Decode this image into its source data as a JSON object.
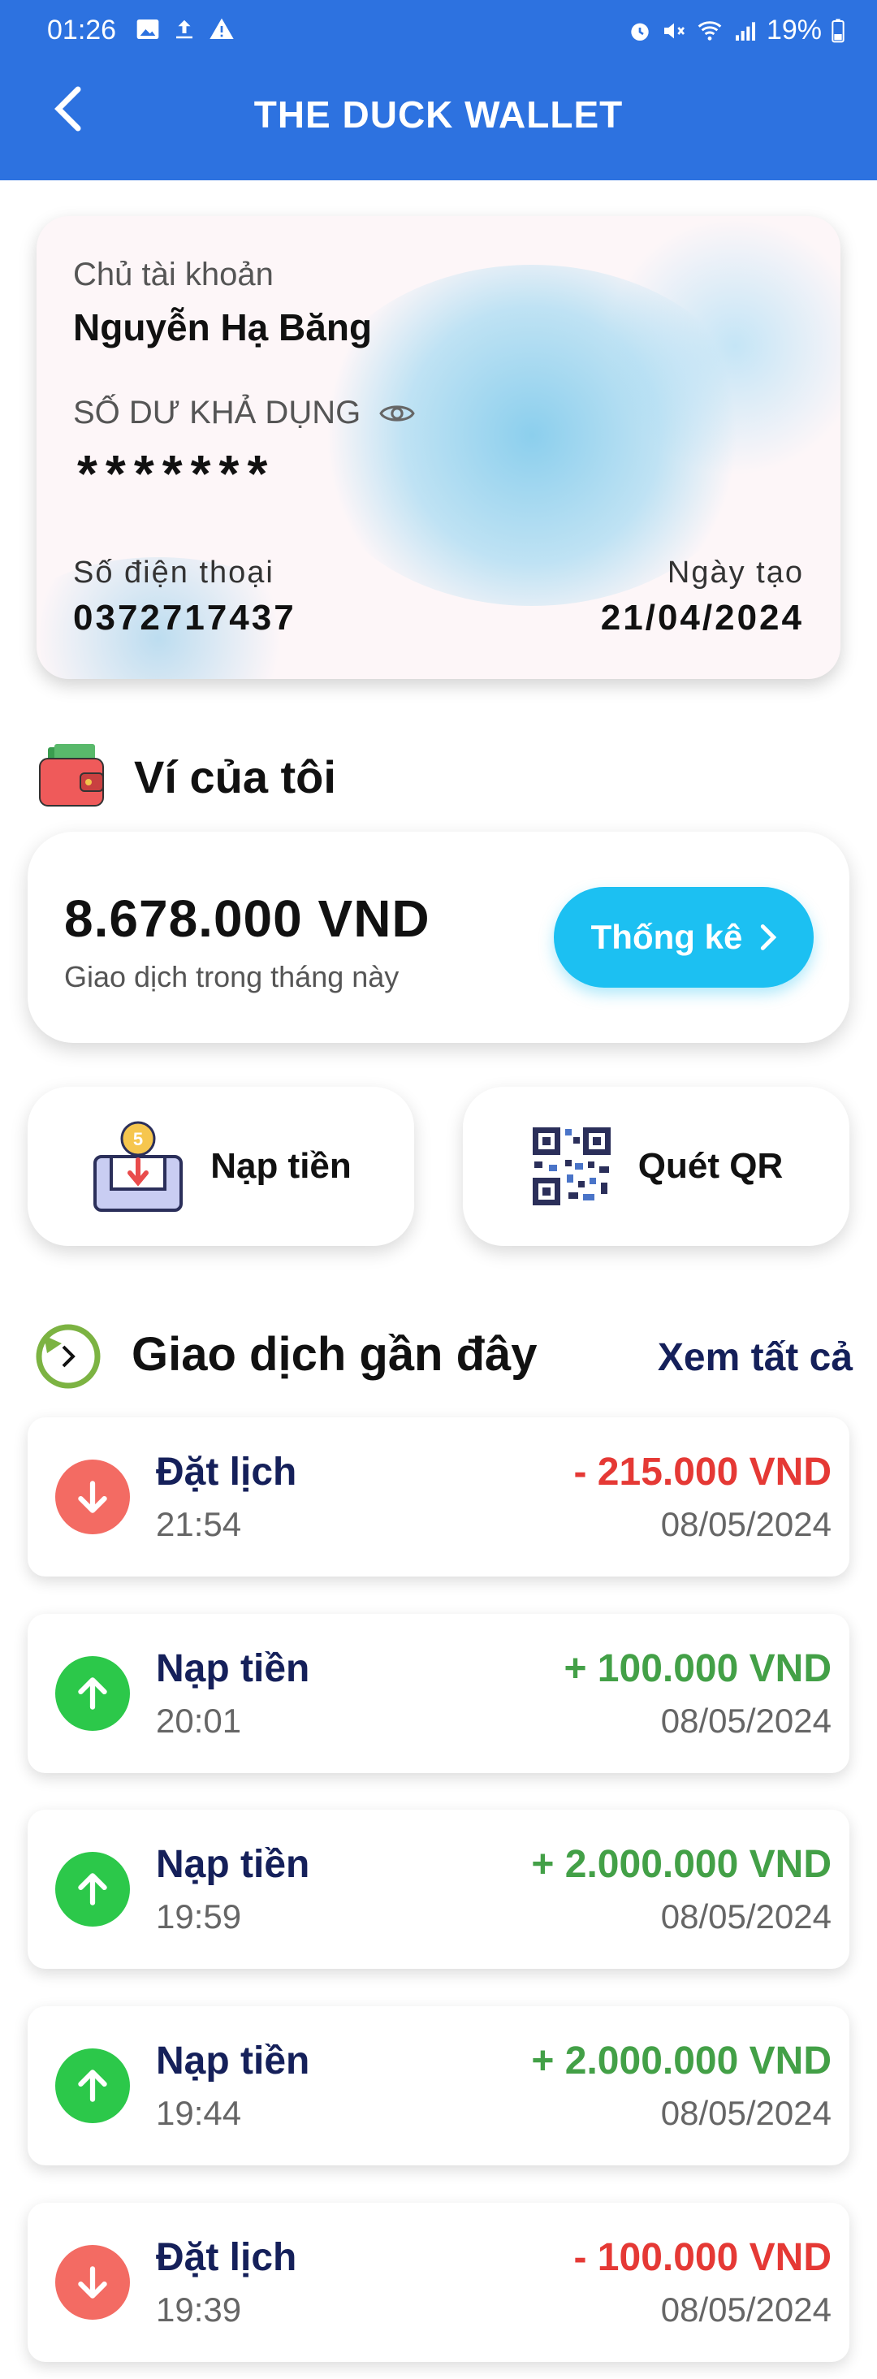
{
  "status_bar": {
    "time": "01:26",
    "battery": "19%",
    "left_icons": [
      "image-icon",
      "upload-icon",
      "warning-icon"
    ],
    "right_icons": [
      "alarm-icon",
      "mute-icon",
      "wifi-icon",
      "signal-icon",
      "battery-icon"
    ]
  },
  "app_bar": {
    "title": "THE DUCK WALLET",
    "back_icon": "back-arrow-icon"
  },
  "account_card": {
    "owner_label": "Chủ tài khoản",
    "owner_name": "Nguyễn Hạ Băng",
    "balance_label": "SỐ DƯ KHẢ DỤNG",
    "balance_masked": "*******",
    "phone_label": "Số điện thoại",
    "phone": "0372717437",
    "created_label": "Ngày tạo",
    "created_date": "21/04/2024"
  },
  "wallet": {
    "title": "Ví của tôi",
    "amount": "8.678.000 VND",
    "subtitle": "Giao dịch trong tháng này",
    "stats_button": "Thống kê"
  },
  "actions": {
    "topup": "Nạp tiền",
    "scan_qr": "Quét QR"
  },
  "recent": {
    "title": "Giao dịch gần đây",
    "see_all": "Xem tất cả",
    "transactions": [
      {
        "type": "Đặt lịch",
        "time": "21:54",
        "amount": "- 215.000 VND",
        "date": "08/05/2024",
        "direction": "out"
      },
      {
        "type": "Nạp tiền",
        "time": "20:01",
        "amount": "+ 100.000 VND",
        "date": "08/05/2024",
        "direction": "in"
      },
      {
        "type": "Nạp tiền",
        "time": "19:59",
        "amount": "+ 2.000.000 VND",
        "date": "08/05/2024",
        "direction": "in"
      },
      {
        "type": "Nạp tiền",
        "time": "19:44",
        "amount": "+ 2.000.000 VND",
        "date": "08/05/2024",
        "direction": "in"
      },
      {
        "type": "Đặt lịch",
        "time": "19:39",
        "amount": "- 100.000 VND",
        "date": "08/05/2024",
        "direction": "out"
      }
    ]
  },
  "colors": {
    "primary": "#2d72e0",
    "accent": "#1cc0f2",
    "income": "#43a047",
    "expense": "#e53935",
    "heading": "#15205a"
  }
}
